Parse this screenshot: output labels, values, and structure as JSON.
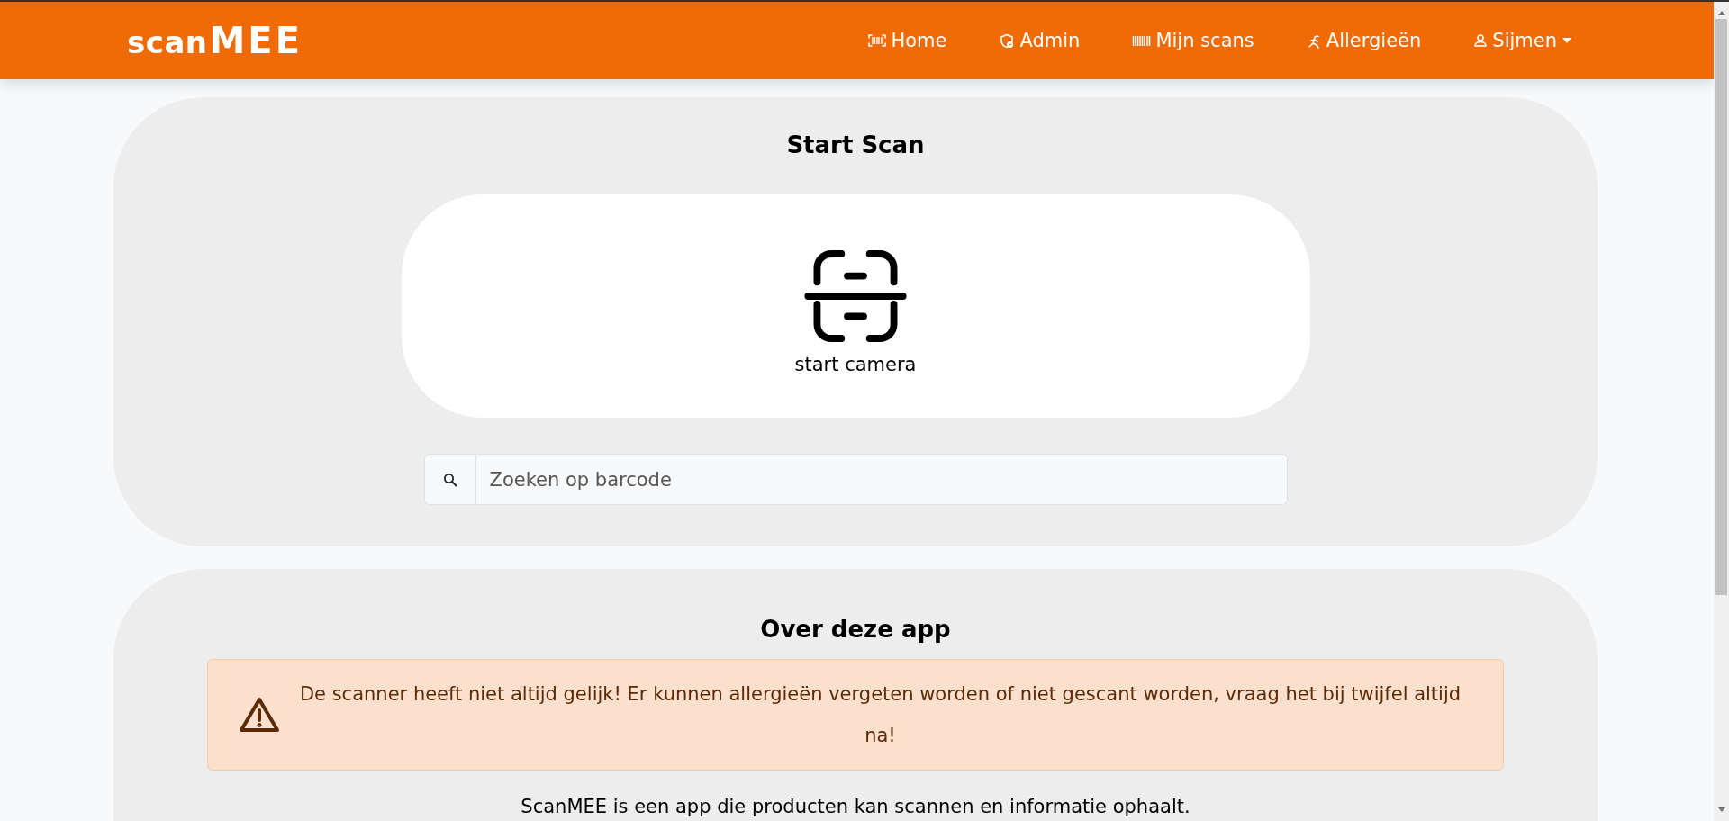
{
  "navbar": {
    "logo": {
      "part_1": "scan",
      "part_2": "MEE"
    },
    "items": [
      {
        "kind": "barcode-scan",
        "label": "Home"
      },
      {
        "kind": "shield",
        "label": "Admin"
      },
      {
        "kind": "barcode",
        "label": "Mijn scans"
      },
      {
        "kind": "person",
        "label": "Allergieën"
      },
      {
        "kind": "user",
        "label": "Sijmen",
        "dropdown": true
      }
    ]
  },
  "scan_card": {
    "title": "Start Scan",
    "camera_button": "start camera",
    "search": {
      "placeholder": "Zoeken op barcode"
    }
  },
  "about_card": {
    "title": "Over deze app",
    "warning": "De scanner heeft niet altijd gelijk! Er kunnen allergieën vergeten worden of niet gescant worden, vraag het bij twijfel altijd na!",
    "description": "ScanMEE is een app die producten kan scannen en informatie ophaalt."
  }
}
